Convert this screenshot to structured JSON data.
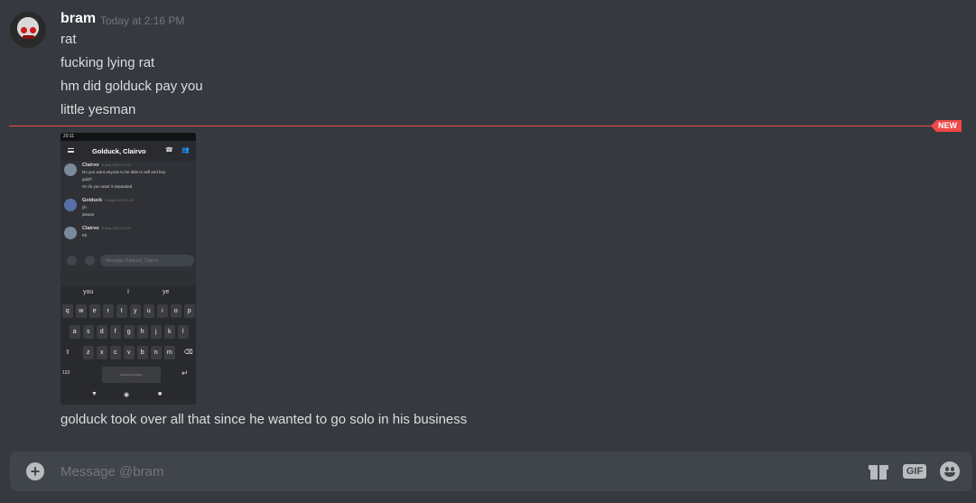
{
  "message": {
    "author": "bram",
    "timestamp": "Today at 2:16 PM",
    "lines": [
      "rat",
      "fucking lying rat",
      "hm did golduck pay you",
      "little yesman"
    ],
    "after_image": "golduck took over all that since he wanted to go solo in his business"
  },
  "divider": {
    "badge": "NEW",
    "color": "#f04747"
  },
  "attachment": {
    "status_time": "20:11",
    "header_title": "Golduck, Clairvo",
    "messages": [
      {
        "name": "Clairvo",
        "time": "6 May 2020 01:19",
        "lines": [
          "Do you want anyone to be able to sell and buy",
          "gold?",
          "Or do you want it separated"
        ]
      },
      {
        "name": "Golduck",
        "time": "6 May 2020 01:19",
        "lines": [
          "yh",
          "please"
        ]
      },
      {
        "name": "Clairvo",
        "time": "6 May 2020 01:19",
        "lines": [
          "Kk"
        ]
      }
    ],
    "input_placeholder": "Message Golduck, Clairvo",
    "suggestions": [
      "you",
      "I",
      "ye"
    ],
    "keyboard": {
      "row1": [
        "q",
        "w",
        "e",
        "r",
        "t",
        "y",
        "u",
        "i",
        "o",
        "p"
      ],
      "row2": [
        "a",
        "s",
        "d",
        "f",
        "g",
        "h",
        "j",
        "k",
        "l"
      ],
      "row3": [
        "z",
        "x",
        "c",
        "v",
        "b",
        "n",
        "m"
      ],
      "num_key": "123",
      "space_label": "Microsoft SwiftKey"
    }
  },
  "composer": {
    "placeholder": "Message @bram",
    "gif_label": "GIF",
    "add_symbol": "+"
  },
  "icons": [
    "add-icon",
    "gift-icon",
    "gif-icon",
    "emoji-icon"
  ],
  "colors": {
    "background": "#36393f",
    "composer": "#40444b",
    "accent_red": "#f04747"
  }
}
